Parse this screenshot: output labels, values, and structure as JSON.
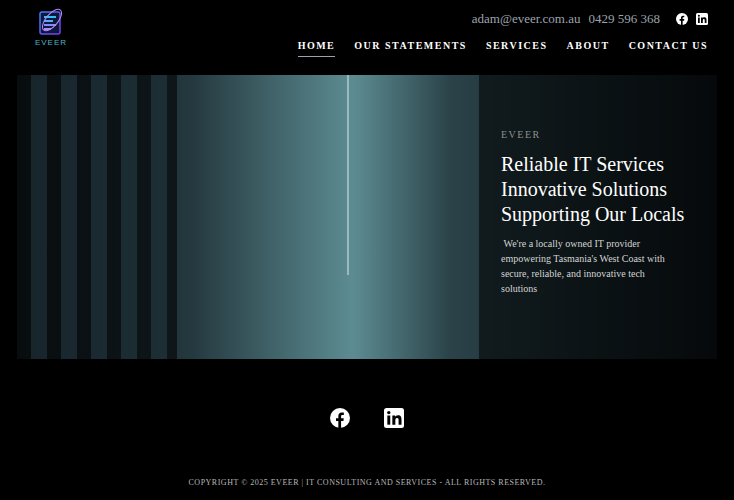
{
  "header": {
    "logo_text": "EVEER",
    "email": "adam@eveer.com.au",
    "phone": "0429 596 368"
  },
  "nav": [
    {
      "label": "HOME",
      "selected": true
    },
    {
      "label": "OUR STATEMENTS",
      "selected": false
    },
    {
      "label": "SERVICES",
      "selected": false
    },
    {
      "label": "ABOUT",
      "selected": false
    },
    {
      "label": "CONTACT US",
      "selected": false
    }
  ],
  "hero": {
    "eyebrow": "EVEER",
    "heading": [
      "Reliable IT Services",
      "Innovative Solutions",
      "Supporting Our Locals"
    ],
    "body": " We're a locally owned IT provider empowering Tasmania's West Coast with secure, reliable, and innovative tech solutions"
  },
  "footer": {
    "copyright": "COPYRIGHT © 2025 EVEER | IT CONSULTING AND SERVICES - ALL RIGHTS RESERVED."
  }
}
